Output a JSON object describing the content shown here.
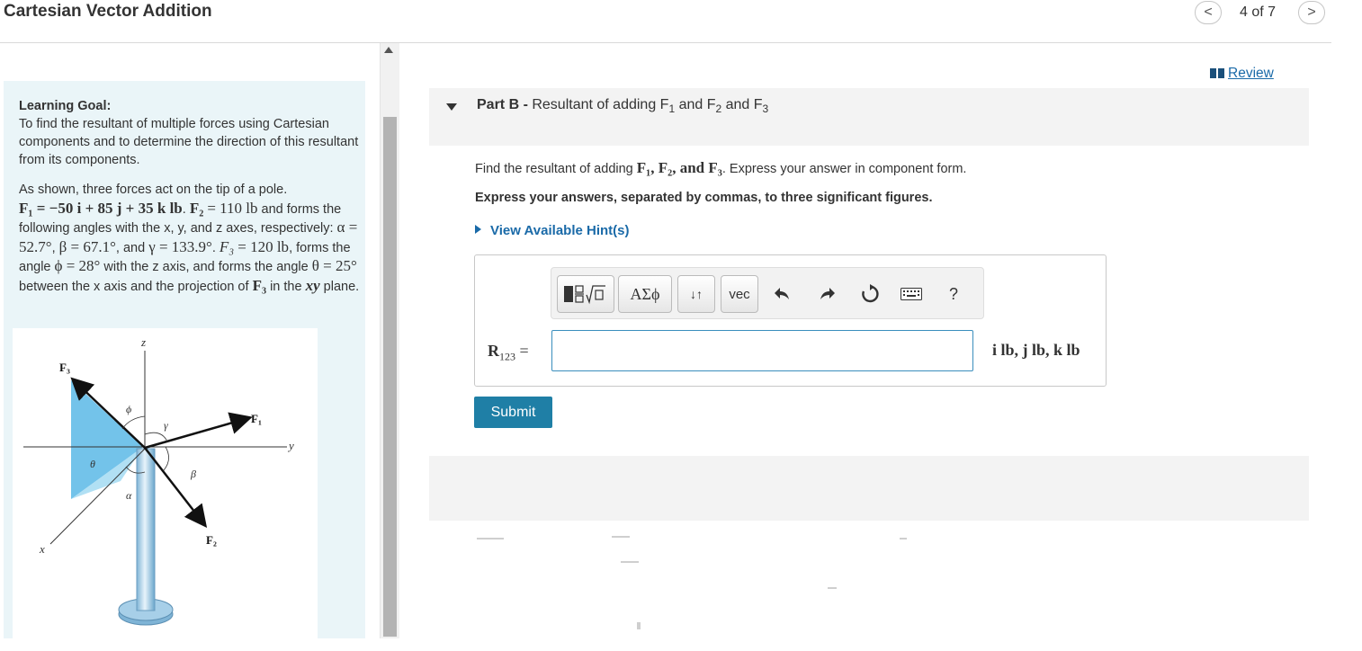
{
  "header": {
    "title": "Cartesian Vector Addition",
    "prev_glyph": "<",
    "next_glyph": ">",
    "page_counter": "4 of 7"
  },
  "review": {
    "label": "Review",
    "icon": "book-icon"
  },
  "learning_goal": {
    "heading": "Learning Goal:",
    "text": "To find the resultant of multiple forces using Cartesian components and to determine the direction of this resultant from its components."
  },
  "problem": {
    "intro": "As shown, three forces act on the tip of a pole.",
    "f1": "F₁ = −50 i + 85 j + 35 k lb",
    "f2_name": "F₂",
    "f2_value": "= 110 lb",
    "angles_text": "and forms the following angles with the x, y, and z axes, respectively:",
    "alpha": "α = 52.7°",
    "beta": "β = 67.1°",
    "gamma": "γ = 133.9°",
    "f3_name": "F₃",
    "f3_value": "= 120 lb",
    "f3_text": "forms the angle",
    "phi": "ϕ = 28°",
    "phi_text": "with the z axis, and forms the angle",
    "theta": "θ = 25°",
    "theta_text": "between the x axis and the projection of",
    "plane_text": "in the",
    "plane": "xy",
    "plane_end": "plane."
  },
  "figure_labels": {
    "z": "z",
    "y": "y",
    "x": "x",
    "F1": "F₁",
    "F2": "F₂",
    "F3": "F₃",
    "phi": "ϕ",
    "gamma": "γ",
    "beta": "β",
    "theta": "θ",
    "alpha": "α"
  },
  "part": {
    "label": "Part B",
    "separator": " - ",
    "title_prefix": "Resultant of adding F",
    "sub1": "1",
    "and1": " and F",
    "sub2": "2",
    "and2": " and F",
    "sub3": "3"
  },
  "question": {
    "prefix": "Find the resultant of adding",
    "vectors": "F₁, F₂, and F₃",
    "suffix": ". Express your answer in component form."
  },
  "instructions": "Express your answers, separated by commas, to three significant figures.",
  "hints_label": "View Available Hint(s)",
  "toolbar": {
    "greek_label": "ΑΣϕ",
    "sort_label": "↓↑",
    "vec_label": "vec",
    "help_label": "?"
  },
  "answer": {
    "label": "R",
    "label_sub": "123",
    "equals": " =",
    "value": "",
    "units": "i lb, j lb, k lb"
  },
  "submit_label": "Submit"
}
